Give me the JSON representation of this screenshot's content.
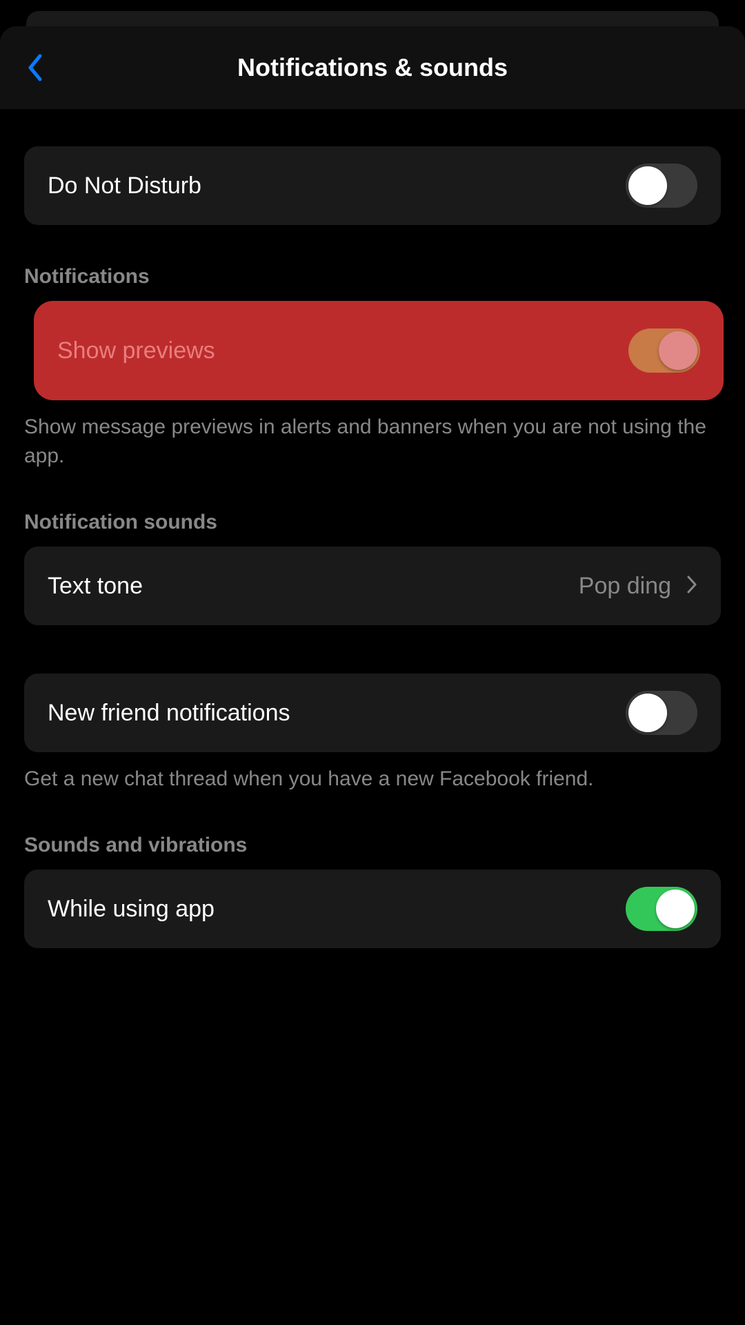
{
  "header": {
    "title": "Notifications & sounds"
  },
  "dnd": {
    "label": "Do Not Disturb",
    "enabled": false
  },
  "sections": {
    "notifications": {
      "header": "Notifications",
      "show_previews": {
        "label": "Show previews",
        "enabled": true,
        "description": "Show message previews in alerts and banners when you are not using the app."
      }
    },
    "notification_sounds": {
      "header": "Notification sounds",
      "text_tone": {
        "label": "Text tone",
        "value": "Pop ding"
      }
    },
    "new_friend": {
      "label": "New friend notifications",
      "enabled": false,
      "description": "Get a new chat thread when you have a new Facebook friend."
    },
    "sounds_vibrations": {
      "header": "Sounds and vibrations",
      "while_using_app": {
        "label": "While using app",
        "enabled": true
      }
    }
  }
}
